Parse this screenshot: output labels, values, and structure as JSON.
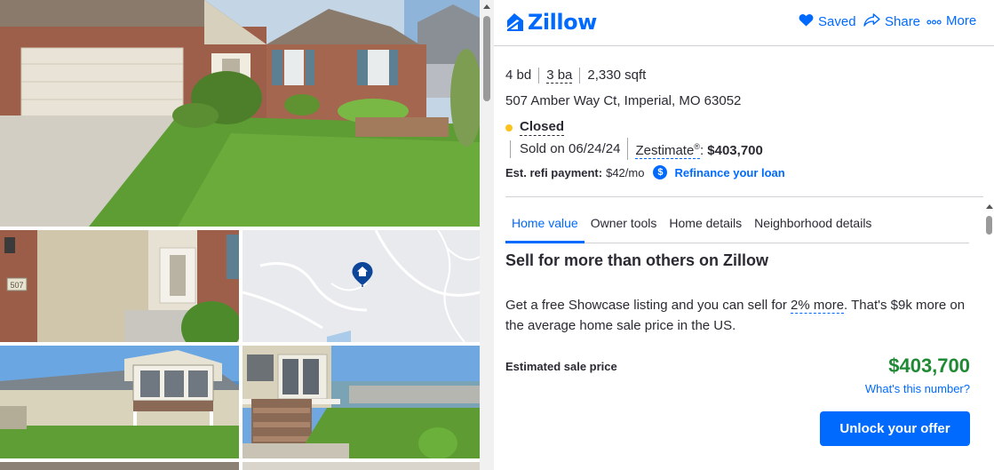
{
  "brand": {
    "name": "Zillow",
    "accent": "#006aff"
  },
  "header": {
    "saved_label": "Saved",
    "share_label": "Share",
    "more_label": "More"
  },
  "listing": {
    "beds": "4 bd",
    "baths": "3 ba",
    "sqft": "2,330 sqft",
    "address": "507 Amber Way Ct, Imperial, MO 63052",
    "status": "Closed",
    "status_color": "#ffc11c",
    "sold_date": "Sold on 06/24/24",
    "zestimate_label": "Zestimate",
    "zestimate_sup": "®",
    "zestimate_value": "$403,700",
    "refi_label": "Est. refi payment:",
    "refi_value": "$42/mo",
    "refi_icon": "$",
    "refi_link": "Refinance your loan"
  },
  "tabs": [
    {
      "label": "Home value",
      "active": true
    },
    {
      "label": "Owner tools",
      "active": false
    },
    {
      "label": "Home details",
      "active": false
    },
    {
      "label": "Neighborhood details",
      "active": false
    }
  ],
  "sell": {
    "heading": "Sell for more than others on Zillow",
    "desc_before": "Get a free Showcase listing and you can sell for ",
    "desc_link": "2% more",
    "desc_after": ". That's $9k more on the average home sale price in the US.",
    "est_label": "Estimated sale price",
    "est_value": "$403,700",
    "est_color": "#1f8a33",
    "whats_link": "What's this number?",
    "cta_label": "Unlock your offer"
  },
  "gallery": {
    "house_number": "507",
    "icons": [
      "home-pin-icon"
    ]
  }
}
